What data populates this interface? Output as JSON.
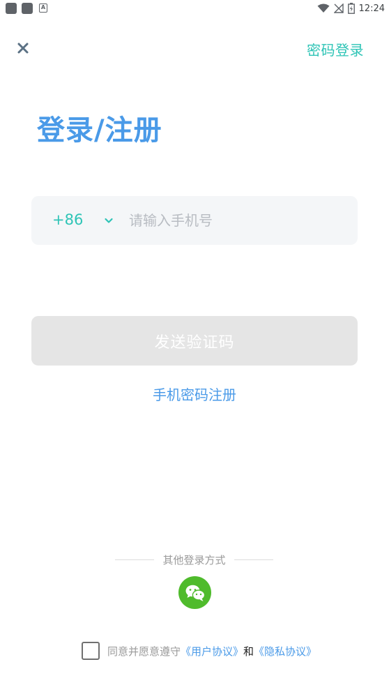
{
  "status_bar": {
    "time": "12:24",
    "left_icons": [
      "app-icon",
      "app-icon",
      "a-icon"
    ],
    "right_icons": [
      "wifi-icon",
      "no-signal-icon",
      "battery-icon"
    ]
  },
  "header": {
    "close_icon": "close-icon",
    "password_login_label": "密码登录"
  },
  "title": "登录/注册",
  "phone_input": {
    "country_code": "+86",
    "dropdown_icon": "chevron-down-icon",
    "placeholder": "请输入手机号",
    "value": ""
  },
  "send_code_button": "发送验证码",
  "register_link": "手机密码注册",
  "other_login": {
    "label": "其他登录方式",
    "wechat_icon": "wechat-icon"
  },
  "agreement": {
    "prefix": "同意并愿意遵守",
    "user_agreement": "《用户协议》",
    "and": "和",
    "privacy_agreement": "《隐私协议》",
    "checked": false
  },
  "colors": {
    "accent_teal": "#2ec4b6",
    "accent_blue": "#4a9ae8",
    "wechat_green": "#4fbb2c",
    "disabled_button": "#e5e5e5",
    "input_bg": "#f4f6f8"
  }
}
